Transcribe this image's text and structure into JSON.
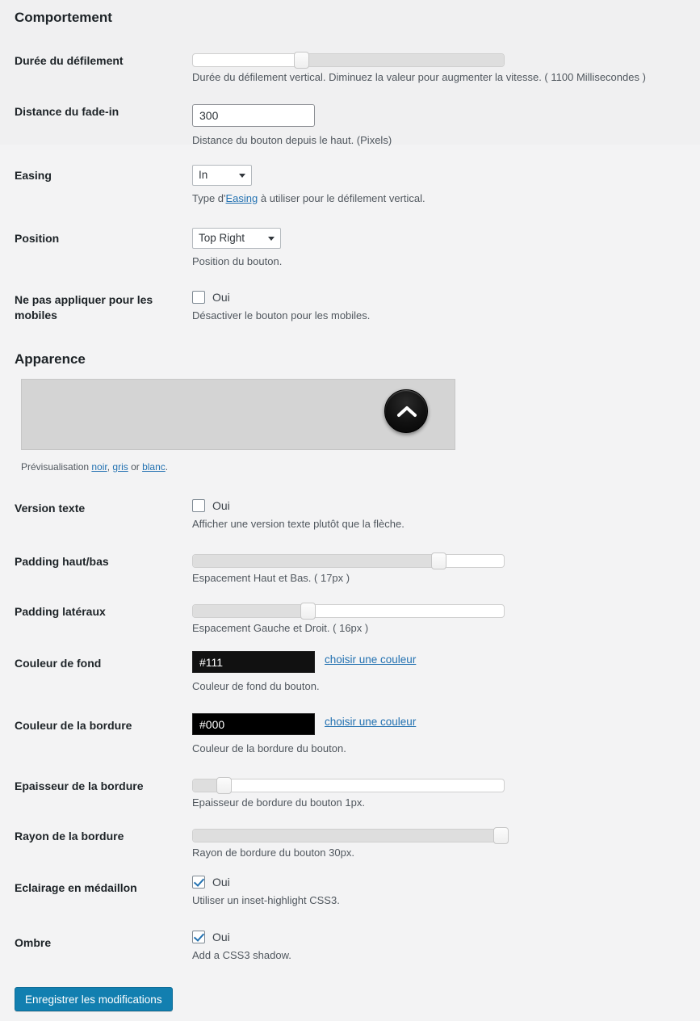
{
  "sections": {
    "behavior": {
      "title": "Comportement"
    },
    "appearance": {
      "title": "Apparence"
    }
  },
  "fields": {
    "scroll_duration": {
      "label": "Durée du défilement",
      "desc": "Durée du défilement vertical. Diminuez la valeur pour augmenter la vitesse. ( 1100 Millisecondes )",
      "value": "1100",
      "unit": "Millisecondes",
      "handle_pct": 35
    },
    "fade_distance": {
      "label": "Distance du fade-in",
      "desc": "Distance du bouton depuis le haut. (Pixels)",
      "value": "300"
    },
    "easing": {
      "label": "Easing",
      "selected": "In",
      "desc_before": "Type d'",
      "desc_link": "Easing",
      "desc_after": " à utiliser pour le défilement vertical."
    },
    "position": {
      "label": "Position",
      "selected": "Top Right",
      "desc": "Position du bouton."
    },
    "disable_mobile": {
      "label": "Ne pas appliquer pour les mobiles",
      "checkbox_label": "Oui",
      "checked": false,
      "desc": "Désactiver le bouton pour les mobiles."
    },
    "text_version": {
      "label": "Version texte",
      "checkbox_label": "Oui",
      "checked": false,
      "desc": "Afficher une version texte plutôt que la flèche."
    },
    "padding_vertical": {
      "label": "Padding haut/bas",
      "desc": "Espacement Haut et Bas. ( 17px )",
      "value": "17",
      "handle_pct": 79
    },
    "padding_horizontal": {
      "label": "Padding latéraux",
      "desc": "Espacement Gauche et Droit. ( 16px )",
      "value": "16",
      "handle_pct": 37
    },
    "background_color": {
      "label": "Couleur de fond",
      "value": "#111",
      "pick_label": "choisir une couleur",
      "desc": "Couleur de fond du bouton."
    },
    "border_color": {
      "label": "Couleur de la bordure",
      "value": "#000",
      "pick_label": "choisir une couleur",
      "desc": "Couleur de la bordure du bouton."
    },
    "border_width": {
      "label": "Epaisseur de la bordure",
      "desc": "Epaisseur de bordure du bouton 1px.",
      "value": "1",
      "handle_pct": 9
    },
    "border_radius": {
      "label": "Rayon de la bordure",
      "desc": "Rayon de bordure du bouton 30px.",
      "value": "30",
      "handle_pct": 98
    },
    "inset_highlight": {
      "label": "Eclairage en médaillon",
      "checkbox_label": "Oui",
      "checked": true,
      "desc": "Utiliser un inset-highlight CSS3."
    },
    "shadow": {
      "label": "Ombre",
      "checkbox_label": "Oui",
      "checked": true,
      "desc": "Add a CSS3 shadow."
    }
  },
  "preview": {
    "intro": "Prévisualisation ",
    "link_black": "noir",
    "sep1": ", ",
    "link_gray": "gris",
    "sep2": " or ",
    "link_white": "blanc",
    "end": ".",
    "button_icon": "chevron-up-icon",
    "button_color": "#111111"
  },
  "submit": {
    "label": "Enregistrer les modifications",
    "color": "#127fb0"
  }
}
